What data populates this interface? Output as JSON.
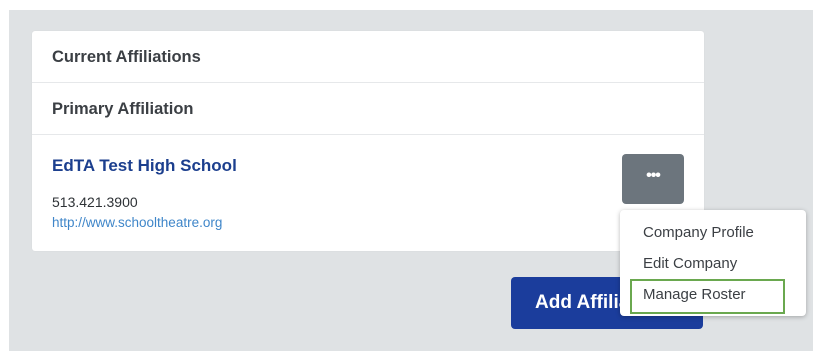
{
  "affiliations": {
    "current_label": "Current Affiliations",
    "primary_label": "Primary Affiliation"
  },
  "company": {
    "name": "EdTA Test High School",
    "phone": "513.421.3900",
    "website": "http://www.schooltheatre.org"
  },
  "actions": {
    "more_label": "•••",
    "add_label": "Add Affiliation"
  },
  "dropdown": {
    "items": [
      {
        "label": "Company Profile"
      },
      {
        "label": "Edit Company"
      },
      {
        "label": "Manage Roster",
        "highlighted": true
      }
    ]
  },
  "colors": {
    "primary_blue": "#1b3d9c",
    "link_blue": "#3f86c9",
    "gray_button": "#6c757d",
    "highlight_green": "#6aa84f"
  }
}
